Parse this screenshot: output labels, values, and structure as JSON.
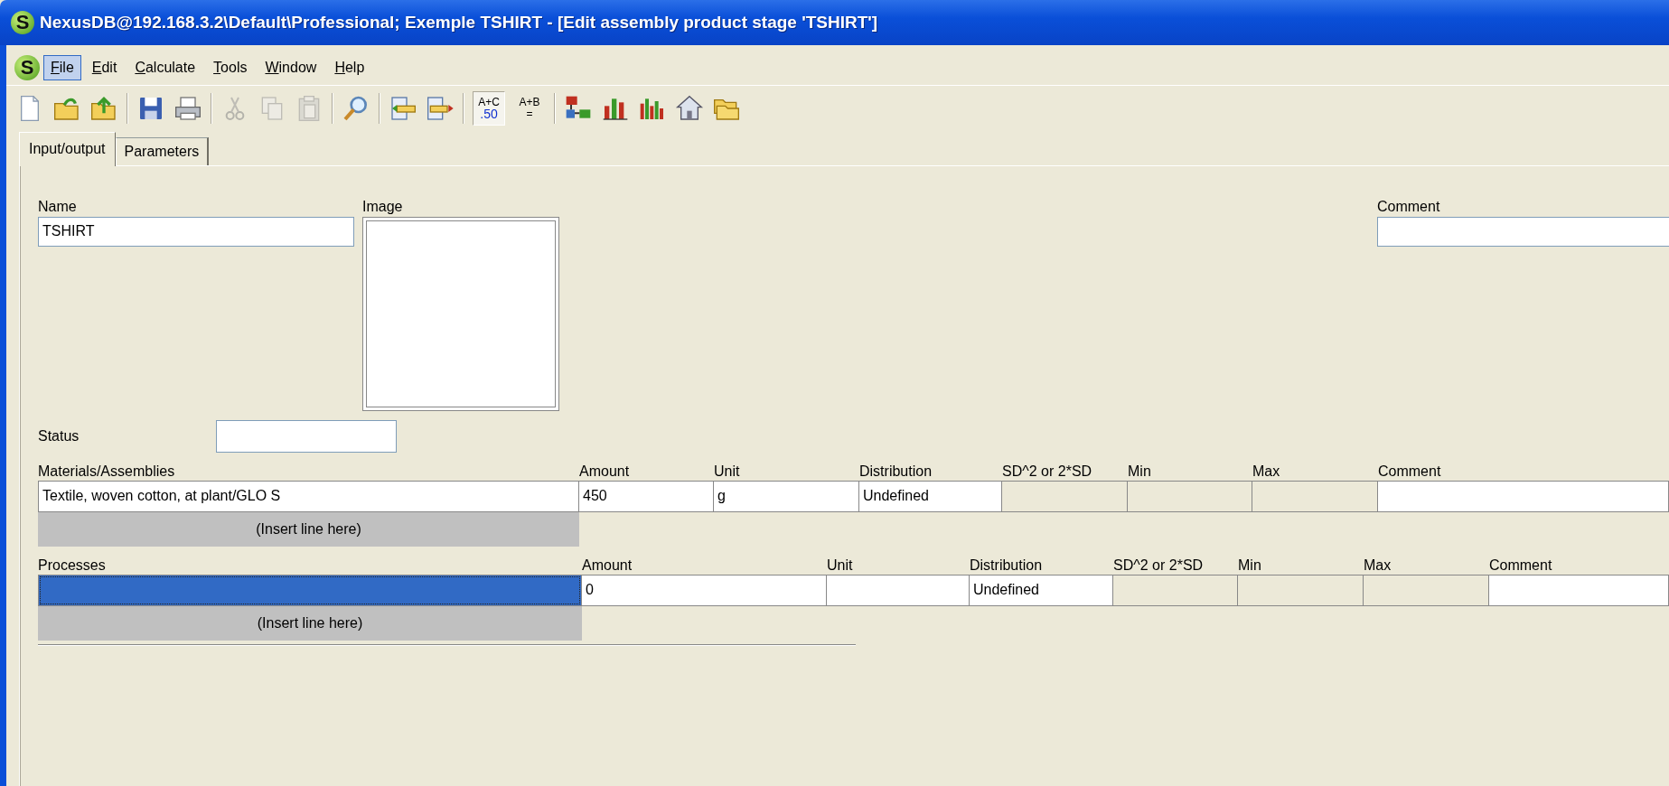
{
  "window": {
    "logo": "S",
    "title": "NexusDB@192.168.3.2\\Default\\Professional; Exemple TSHIRT - [Edit assembly product stage 'TSHIRT']"
  },
  "menu": {
    "logo": "S",
    "items": [
      {
        "label": "File",
        "selected": true
      },
      {
        "label": "Edit",
        "selected": false
      },
      {
        "label": "Calculate",
        "selected": false
      },
      {
        "label": "Tools",
        "selected": false
      },
      {
        "label": "Window",
        "selected": false
      },
      {
        "label": "Help",
        "selected": false
      }
    ]
  },
  "toolbar": [
    {
      "kind": "new",
      "disabled": false
    },
    {
      "kind": "open",
      "disabled": false
    },
    {
      "kind": "export",
      "disabled": false
    },
    {
      "kind": "sep"
    },
    {
      "kind": "save",
      "disabled": false
    },
    {
      "kind": "print",
      "disabled": false
    },
    {
      "kind": "sep"
    },
    {
      "kind": "cut",
      "disabled": true
    },
    {
      "kind": "copy",
      "disabled": true
    },
    {
      "kind": "paste",
      "disabled": true
    },
    {
      "kind": "sep"
    },
    {
      "kind": "search",
      "disabled": false
    },
    {
      "kind": "sep"
    },
    {
      "kind": "list-left",
      "disabled": false
    },
    {
      "kind": "list-right",
      "disabled": false
    },
    {
      "kind": "sep"
    },
    {
      "kind": "text",
      "lines": [
        "A+C",
        ".50"
      ],
      "pressed": true
    },
    {
      "kind": "text",
      "lines": [
        "A+B",
        "="
      ],
      "pressed": false
    },
    {
      "kind": "sep"
    },
    {
      "kind": "network",
      "disabled": false
    },
    {
      "kind": "chart",
      "disabled": false
    },
    {
      "kind": "chart2",
      "disabled": false
    },
    {
      "kind": "house",
      "disabled": false
    },
    {
      "kind": "folders",
      "disabled": false
    }
  ],
  "tabs": [
    {
      "label": "Input/output",
      "selected": true
    },
    {
      "label": "Parameters",
      "selected": false
    }
  ],
  "form": {
    "name_label": "Name",
    "name_value": "TSHIRT",
    "image_label": "Image",
    "comment_label": "Comment",
    "status_label": "Status"
  },
  "tables": [
    {
      "columns": [
        "Materials/Assemblies",
        "Amount",
        "Unit",
        "Distribution",
        "SD^2 or 2*SD",
        "Min",
        "Max",
        "Comment"
      ],
      "rows": [
        {
          "cells": [
            {
              "text": "Textile, woven cotton, at plant/GLO S",
              "kind": "input",
              "selected": false
            },
            {
              "text": "450",
              "kind": "input",
              "selected": false
            },
            {
              "text": "g",
              "kind": "input",
              "selected": false
            },
            {
              "text": "Undefined",
              "kind": "input",
              "selected": false
            },
            {
              "kind": "readonly",
              "selected": false
            },
            {
              "kind": "readonly",
              "selected": false
            },
            {
              "kind": "readonly",
              "selected": false
            },
            {
              "kind": "input",
              "selected": false
            }
          ]
        }
      ],
      "insert_label": "(Insert line here)"
    },
    {
      "columns": [
        "Processes",
        "Amount",
        "Unit",
        "Distribution",
        "SD^2 or 2*SD",
        "Min",
        "Max",
        "Comment"
      ],
      "rows": [
        {
          "cells": [
            {
              "kind": "input",
              "selected": true
            },
            {
              "text": "0",
              "kind": "input",
              "selected": false
            },
            {
              "kind": "input",
              "selected": false
            },
            {
              "text": "Undefined",
              "kind": "input",
              "selected": false
            },
            {
              "kind": "readonly",
              "selected": false
            },
            {
              "kind": "readonly",
              "selected": false
            },
            {
              "kind": "readonly",
              "selected": false
            },
            {
              "kind": "input",
              "selected": false
            }
          ]
        }
      ],
      "insert_label": "(Insert line here)"
    }
  ]
}
